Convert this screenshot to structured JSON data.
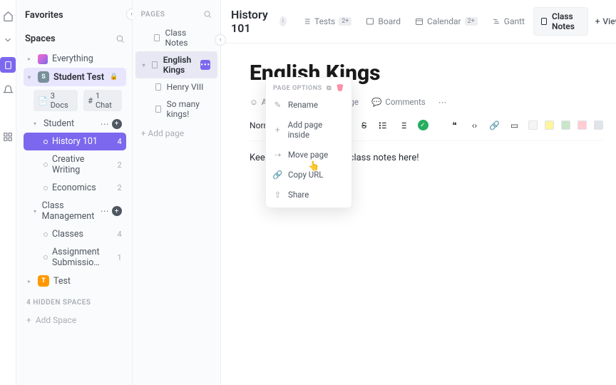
{
  "rail": {
    "active_index": 2
  },
  "sidebar": {
    "favorites_label": "Favorites",
    "spaces_label": "Spaces",
    "everything_label": "Everything",
    "spaces": [
      {
        "name": "Student Test",
        "initial": "S",
        "locked": true,
        "selected": true,
        "chips": [
          {
            "label": "3 Docs",
            "icon": "doc"
          },
          {
            "label": "1 Chat",
            "icon": "hash"
          }
        ],
        "folders": [
          {
            "name": "Student",
            "lists": [
              {
                "name": "History 101",
                "count": "4",
                "active": true
              },
              {
                "name": "Creative Writing",
                "count": "2"
              },
              {
                "name": "Economics",
                "count": "2"
              }
            ]
          },
          {
            "name": "Class Management",
            "lists": [
              {
                "name": "Classes",
                "count": "4"
              },
              {
                "name": "Assignment Submissio…",
                "count": "1"
              }
            ]
          }
        ]
      },
      {
        "name": "Test",
        "initial": "T",
        "color": "orange"
      }
    ],
    "hidden_label": "4 HIDDEN SPACES",
    "add_space_label": "Add Space"
  },
  "pages": {
    "header": "PAGES",
    "items": [
      {
        "title": "Class Notes",
        "indent": 0
      },
      {
        "title": "English Kings",
        "indent": 0,
        "selected": true,
        "expanded": true
      },
      {
        "title": "Henry VIII",
        "indent": 1
      },
      {
        "title": "So many kings!",
        "indent": 1
      }
    ],
    "add_page_label": "+ Add page"
  },
  "context_menu": {
    "title": "PAGE OPTIONS",
    "items": [
      {
        "label": "Rename",
        "icon": "pencil"
      },
      {
        "label": "Add page inside",
        "icon": "plus"
      },
      {
        "label": "Move page",
        "icon": "move"
      },
      {
        "label": "Copy URL",
        "icon": "link"
      },
      {
        "label": "Share",
        "icon": "share"
      }
    ]
  },
  "topbar": {
    "title": "History 101",
    "views": [
      {
        "label": "Tests",
        "icon": "list",
        "badge": "2+"
      },
      {
        "label": "Board",
        "icon": "board"
      },
      {
        "label": "Calendar",
        "icon": "calendar",
        "badge": "2+"
      },
      {
        "label": "Gantt",
        "icon": "gantt"
      },
      {
        "label": "Class Notes",
        "icon": "doc",
        "active": true
      }
    ],
    "add_view_label": "View"
  },
  "document": {
    "title": "English Kings",
    "actions": {
      "add_icon": "Add Icon",
      "share_page": "Share Page",
      "comments": "Comments"
    },
    "toolbar": {
      "style_select": "Normal",
      "swatches": [
        "#f5f5f5",
        "#fff59d",
        "#c8e6c9",
        "#ffcdd2",
        "#e1e4e8"
      ]
    },
    "body": "Keep track of all of your class notes here!"
  }
}
